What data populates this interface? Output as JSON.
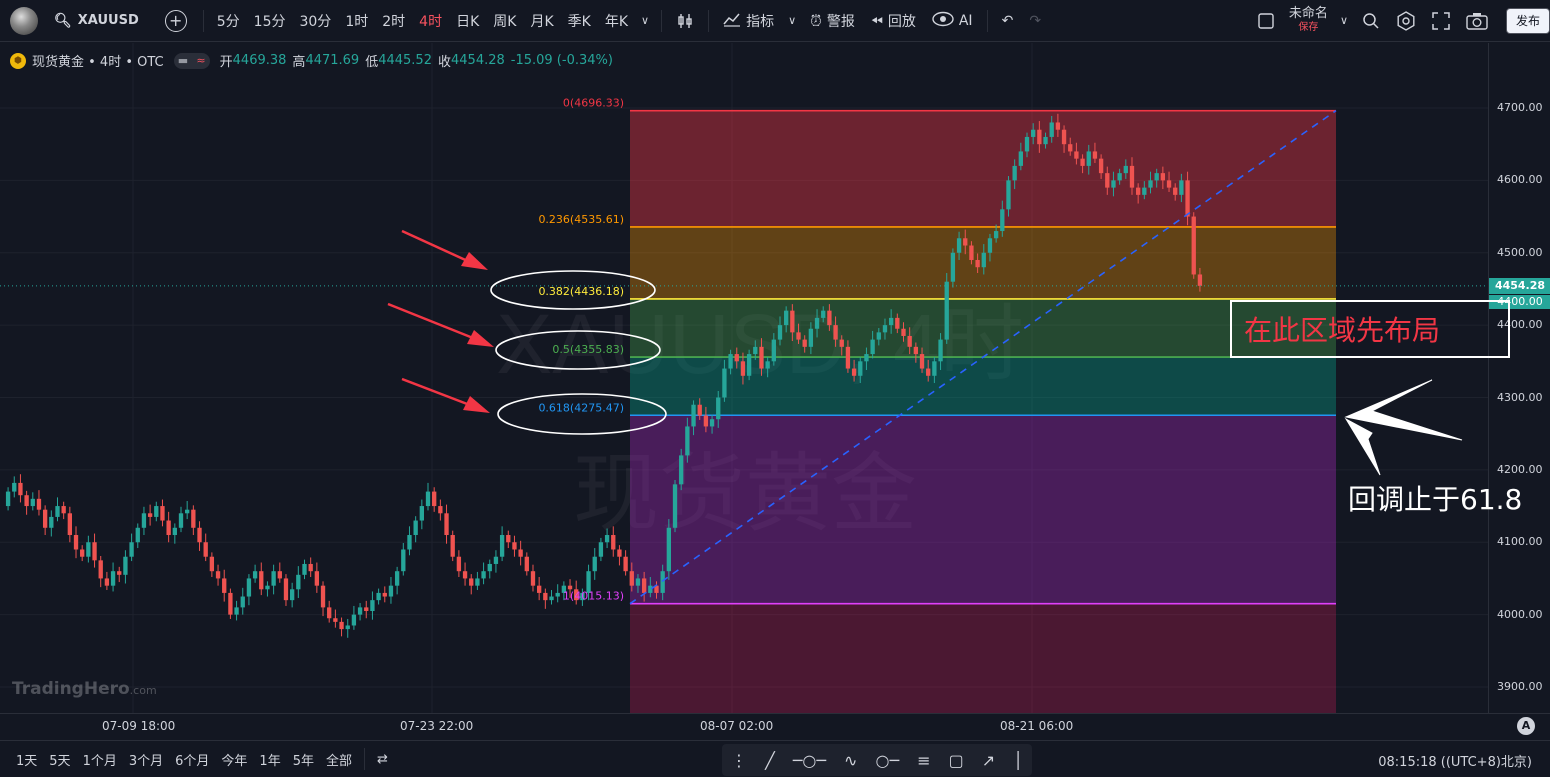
{
  "toolbar": {
    "symbol": "XAUUSD",
    "intervals": [
      "5分",
      "15分",
      "30分",
      "1时",
      "2时",
      "4时",
      "日K",
      "周K",
      "月K",
      "季K",
      "年K"
    ],
    "active_interval": "4时",
    "indicators_label": "指标",
    "alert_label": "警报",
    "replay_label": "回放",
    "ai_label": "AI",
    "layout_name": "未命名",
    "layout_saved": "保存",
    "publish_label": "发布"
  },
  "legend": {
    "symbol_text": "现货黄金 • 4时 • OTC",
    "open_label": "开",
    "open": "4469.38",
    "high_label": "高",
    "high": "4471.69",
    "low_label": "低",
    "low": "4445.52",
    "close_label": "收",
    "close": "4454.28",
    "change": "-15.09 (-0.34%)"
  },
  "watermark": {
    "line1": "XAUUSD, 4时",
    "line2": "现货黄金",
    "brand": "TradingHero",
    "brand_suffix": ".com"
  },
  "price_axis": {
    "ticks": [
      "4700.00",
      "4600.00",
      "4500.00",
      "4400.00",
      "4300.00",
      "4200.00",
      "4100.00",
      "4000.00",
      "3900.00"
    ],
    "last_price": "4454.28",
    "cursor_price": "4400.00"
  },
  "time_axis": {
    "ticks": [
      "07-09 18:00",
      "07-23 22:00",
      "08-07 02:00",
      "08-21 06:00"
    ]
  },
  "fib": {
    "levels": [
      {
        "ratio": "0",
        "price": "4696.33",
        "label": "0(4696.33)",
        "line_color": "#f23645",
        "fill_color": "#f2364566",
        "label_color": "#f23645"
      },
      {
        "ratio": "0.236",
        "price": "4535.61",
        "label": "0.236(4535.61)",
        "line_color": "#ff9800",
        "fill_color": "#ff980055",
        "label_color": "#ff9800"
      },
      {
        "ratio": "0.382",
        "price": "4436.18",
        "label": "0.382(4436.18)",
        "line_color": "#ffeb3b",
        "fill_color": "#4caf5055",
        "label_color": "#ffeb3b"
      },
      {
        "ratio": "0.5",
        "price": "4355.83",
        "label": "0.5(4355.83)",
        "line_color": "#4caf50",
        "fill_color": "#08998166",
        "label_color": "#4caf50"
      },
      {
        "ratio": "0.618",
        "price": "4275.47",
        "label": "0.618(4275.47)",
        "line_color": "#2196f3",
        "fill_color": "#9c27b066",
        "label_color": "#2196f3"
      },
      {
        "ratio": "1",
        "price": "4015.13",
        "label": "1(4015.13)",
        "line_color": "#e040fb",
        "fill_color": "#e91e6344",
        "label_color": "#e040fb"
      }
    ]
  },
  "annotations": {
    "zone_text": "在此区域先布局",
    "stop_text": "回调止于61.8"
  },
  "bottom": {
    "ranges": [
      "1天",
      "5天",
      "1个月",
      "3个月",
      "6个月",
      "今年",
      "1年",
      "5年",
      "全部"
    ],
    "clock": "08:15:18 ((UTC+8)北京)"
  },
  "chart_data": {
    "type": "candlestick",
    "title": "",
    "symbol": "XAUUSD",
    "interval": "4时",
    "ylim": [
      3860,
      4760
    ],
    "x_labels": [
      "07-09 18:00",
      "07-23 22:00",
      "08-07 02:00",
      "08-21 06:00"
    ],
    "grid": true,
    "up_color": "#26a69a",
    "down_color": "#ef5350",
    "closes": [
      4170,
      4182,
      4165,
      4150,
      4160,
      4145,
      4120,
      4135,
      4150,
      4140,
      4110,
      4090,
      4080,
      4100,
      4075,
      4050,
      4040,
      4060,
      4055,
      4080,
      4100,
      4120,
      4140,
      4135,
      4150,
      4130,
      4110,
      4120,
      4140,
      4145,
      4120,
      4100,
      4080,
      4060,
      4050,
      4030,
      4000,
      4010,
      4025,
      4050,
      4060,
      4035,
      4040,
      4060,
      4050,
      4020,
      4035,
      4055,
      4070,
      4060,
      4040,
      4010,
      3995,
      3990,
      3980,
      3985,
      4000,
      4010,
      4005,
      4020,
      4030,
      4025,
      4040,
      4060,
      4090,
      4110,
      4130,
      4150,
      4170,
      4150,
      4140,
      4110,
      4080,
      4060,
      4050,
      4040,
      4050,
      4060,
      4070,
      4080,
      4110,
      4100,
      4090,
      4080,
      4060,
      4040,
      4030,
      4020,
      4025,
      4030,
      4040,
      4035,
      4020,
      4030,
      4060,
      4080,
      4100,
      4110,
      4090,
      4080,
      4060,
      4040,
      4050,
      4030,
      4040,
      4030,
      4060,
      4120,
      4180,
      4220,
      4260,
      4290,
      4275,
      4260,
      4270,
      4300,
      4340,
      4360,
      4350,
      4330,
      4360,
      4370,
      4340,
      4350,
      4380,
      4400,
      4420,
      4390,
      4380,
      4370,
      4395,
      4410,
      4420,
      4400,
      4380,
      4370,
      4340,
      4330,
      4350,
      4360,
      4380,
      4390,
      4400,
      4410,
      4395,
      4385,
      4370,
      4360,
      4340,
      4330,
      4350,
      4380,
      4460,
      4500,
      4520,
      4510,
      4490,
      4480,
      4500,
      4520,
      4530,
      4560,
      4600,
      4620,
      4640,
      4660,
      4670,
      4650,
      4660,
      4680,
      4670,
      4650,
      4640,
      4630,
      4620,
      4640,
      4630,
      4610,
      4590,
      4600,
      4610,
      4620,
      4590,
      4580,
      4590,
      4600,
      4610,
      4600,
      4590,
      4580,
      4600,
      4550,
      4470,
      4454.28
    ]
  }
}
